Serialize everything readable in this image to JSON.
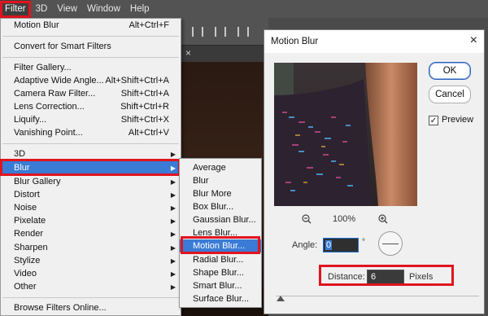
{
  "menubar": {
    "items": [
      "Filter",
      "3D",
      "View",
      "Window",
      "Help"
    ]
  },
  "filter_menu": {
    "items": [
      {
        "label": "Motion Blur",
        "shortcut": "Alt+Ctrl+F"
      },
      {
        "label": "Convert for Smart Filters",
        "shortcut": ""
      },
      {
        "label": "Filter Gallery...",
        "shortcut": ""
      },
      {
        "label": "Adaptive Wide Angle...",
        "shortcut": "Alt+Shift+Ctrl+A"
      },
      {
        "label": "Camera Raw Filter...",
        "shortcut": "Shift+Ctrl+A"
      },
      {
        "label": "Lens Correction...",
        "shortcut": "Shift+Ctrl+R"
      },
      {
        "label": "Liquify...",
        "shortcut": "Shift+Ctrl+X"
      },
      {
        "label": "Vanishing Point...",
        "shortcut": "Alt+Ctrl+V"
      },
      {
        "label": "3D",
        "shortcut": ""
      },
      {
        "label": "Blur",
        "shortcut": ""
      },
      {
        "label": "Blur Gallery",
        "shortcut": ""
      },
      {
        "label": "Distort",
        "shortcut": ""
      },
      {
        "label": "Noise",
        "shortcut": ""
      },
      {
        "label": "Pixelate",
        "shortcut": ""
      },
      {
        "label": "Render",
        "shortcut": ""
      },
      {
        "label": "Sharpen",
        "shortcut": ""
      },
      {
        "label": "Stylize",
        "shortcut": ""
      },
      {
        "label": "Video",
        "shortcut": ""
      },
      {
        "label": "Other",
        "shortcut": ""
      },
      {
        "label": "Browse Filters Online...",
        "shortcut": ""
      }
    ]
  },
  "blur_submenu": {
    "items": [
      "Average",
      "Blur",
      "Blur More",
      "Box Blur...",
      "Gaussian Blur...",
      "Lens Blur...",
      "Motion Blur...",
      "Radial Blur...",
      "Shape Blur...",
      "Smart Blur...",
      "Surface Blur..."
    ]
  },
  "dialog": {
    "title": "Motion Blur",
    "close_icon": "×",
    "ok_label": "OK",
    "cancel_label": "Cancel",
    "preview_label": "Preview",
    "preview_checked": true,
    "zoom_level": "100%",
    "angle_label": "Angle:",
    "angle_value": "0",
    "degree_symbol": "°",
    "distance_label": "Distance:",
    "distance_value": "6",
    "distance_unit": "Pixels"
  },
  "colors": {
    "highlight_border": "#e0141e",
    "selection": "#3a7bd5"
  }
}
